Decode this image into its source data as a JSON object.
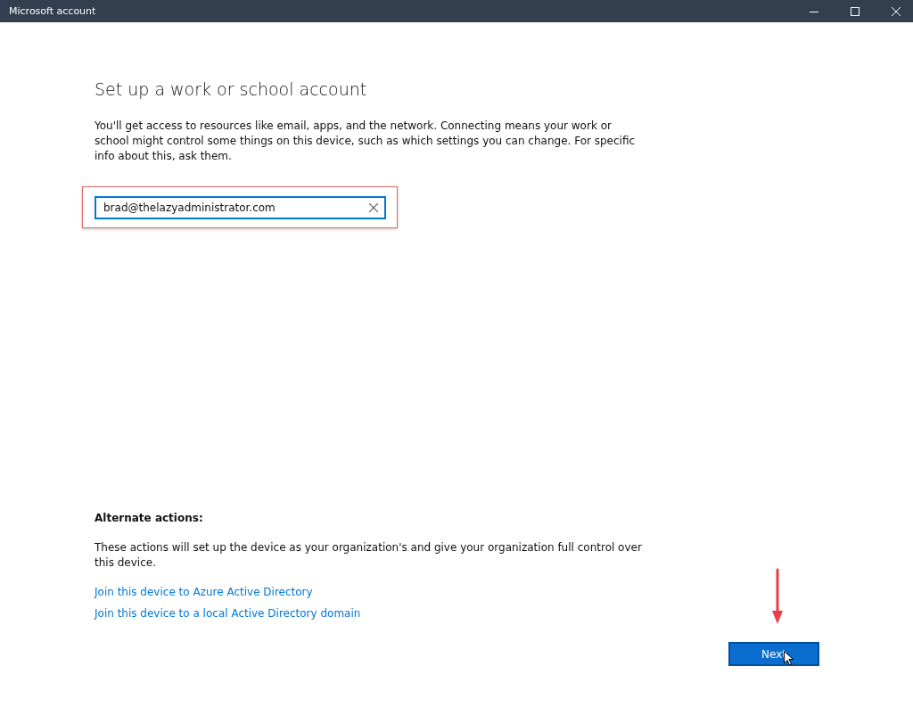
{
  "window": {
    "title": "Microsoft account"
  },
  "heading": "Set up a work or school account",
  "description": "You'll get access to resources like email, apps, and the network. Connecting means your work or school might control some things on this device, such as which settings you can change. For specific info about this, ask them.",
  "email_field": {
    "value": "brad@thelazyadministrator.com"
  },
  "alternate": {
    "title": "Alternate actions:",
    "description": "These actions will set up the device as your organization's and give your organization full control over this device.",
    "links": [
      "Join this device to Azure Active Directory",
      "Join this device to a local Active Directory domain"
    ]
  },
  "next_button": "Next"
}
